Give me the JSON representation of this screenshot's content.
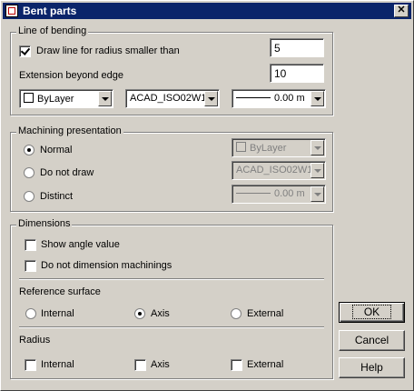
{
  "window": {
    "title": "Bent parts"
  },
  "line_of_bending": {
    "legend": "Line of bending",
    "draw_line_label": "Draw line for radius smaller than",
    "draw_line_checked": true,
    "radius_value": "5",
    "extension_label": "Extension beyond edge",
    "extension_value": "10",
    "color_combo": "ByLayer",
    "linetype_combo": "ACAD_ISO02W1",
    "lineweight_combo": "0.00 m"
  },
  "machining": {
    "legend": "Machining presentation",
    "options": [
      "Normal",
      "Do not draw",
      "Distinct"
    ],
    "selected": "Normal",
    "color_combo": "ByLayer",
    "linetype_combo": "ACAD_ISO02W1",
    "lineweight_combo": "0.00 m"
  },
  "dimensions": {
    "legend": "Dimensions",
    "show_angle_label": "Show angle value",
    "no_machinings_label": "Do not dimension machinings",
    "reference_surface_label": "Reference surface",
    "reference_options": [
      "Internal",
      "Axis",
      "External"
    ],
    "reference_selected": "Axis",
    "radius_label": "Radius",
    "radius_options": [
      "Internal",
      "Axis",
      "External"
    ]
  },
  "buttons": {
    "ok": "OK",
    "cancel": "Cancel",
    "help": "Help"
  }
}
